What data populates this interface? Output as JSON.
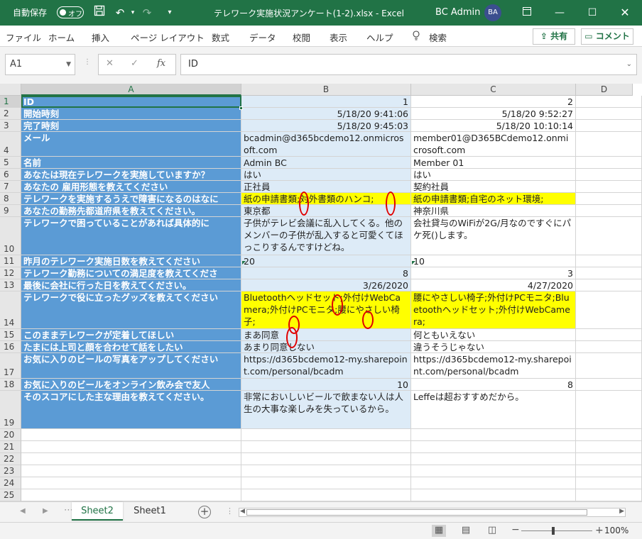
{
  "titlebar": {
    "autosave_label": "自動保存",
    "autosave_state": "オフ",
    "document_title": "テレワーク実施状況アンケート(1-2).xlsx  -  Excel",
    "user_name": "BC Admin",
    "user_initials": "BA"
  },
  "menu": {
    "file": "ファイル",
    "home": "ホーム",
    "insert": "挿入",
    "page_layout": "ページ レイアウト",
    "formulas": "数式",
    "data": "データ",
    "review": "校閲",
    "view": "表示",
    "help": "ヘルプ",
    "search": "検索",
    "share": "共有",
    "comments": "コメント"
  },
  "formula_bar": {
    "name_box": "A1",
    "fx": "fx",
    "value": "ID"
  },
  "columns": [
    "A",
    "B",
    "C",
    "D"
  ],
  "rows": [
    {
      "n": "1",
      "a": "ID",
      "b": "1",
      "c": "2"
    },
    {
      "n": "2",
      "a": "開始時刻",
      "b": "5/18/20 9:41:06",
      "c": "5/18/20 9:52:27"
    },
    {
      "n": "3",
      "a": "完了時刻",
      "b": "5/18/20 9:45:03",
      "c": "5/18/20 10:10:14"
    },
    {
      "n": "4",
      "a": "メール",
      "b": "bcadmin@d365bcdemo12.onmicrosoft.com",
      "c": "member01@D365BCdemo12.onmicrosoft.com"
    },
    {
      "n": "5",
      "a": "名前",
      "b": "Admin BC",
      "c": "Member 01"
    },
    {
      "n": "6",
      "a": "あなたは現在テレワークを実施していますか？",
      "b": "はい",
      "c": "はい"
    },
    {
      "n": "7",
      "a": "あなたの 雇用形態を教えてください",
      "b": "正社員",
      "c": "契約社員"
    },
    {
      "n": "8",
      "a": "テレワークを実施するうえで障害になるのはなに",
      "b": "紙の申請書類;対外書類のハンコ;",
      "c": "紙の申請書類;自宅のネット環境;"
    },
    {
      "n": "9",
      "a": "あなたの勤務先都道府県を教えてください。",
      "b": "東京都",
      "c": "神奈川県"
    },
    {
      "n": "10",
      "a": "テレワークで困っていることがあれば具体的に",
      "b": "子供がテレビ会議に乱入してくる。他のメンバーの子供が乱入すると可愛くてほっこりするんですけどね。",
      "c": "会社貸与のWiFiが2G/月なのですぐにパケ死()します。"
    },
    {
      "n": "11",
      "a": "昨月のテレワーク実施日数を教えてください",
      "b": "20",
      "c": "10"
    },
    {
      "n": "12",
      "a": "テレワーク勤務についての満足度を教えてくださ",
      "b": "8",
      "c": "3"
    },
    {
      "n": "13",
      "a": "最後に会社に行った日を教えてください。",
      "b": "3/26/2020",
      "c": "4/27/2020"
    },
    {
      "n": "14",
      "a": "テレワークで役に立ったグッズを教えてください",
      "b": "Bluetoothヘッドセット;外付けWebCamera;外付けPCモニタ;腰にやさしい椅子;",
      "c": "腰にやさしい椅子;外付けPCモニタ;Bluetoothヘッドセット;外付けWebCamera;"
    },
    {
      "n": "15",
      "a": "このままテレワークが定着してほしい",
      "b": "まあ同意",
      "c": "何ともいえない"
    },
    {
      "n": "16",
      "a": "たまには上司と顔を合わせて話をしたい",
      "b": "あまり同意しない",
      "c": "違うそうじゃない"
    },
    {
      "n": "17",
      "a": "お気に入りのビールの写真をアップしてください",
      "b": "https://d365bcdemo12-my.sharepoint.com/personal/bcadm",
      "c": "https://d365bcdemo12-my.sharepoint.com/personal/bcadm"
    },
    {
      "n": "18",
      "a": "お気に入りのビールをオンライン飲み会で友人",
      "b": "10",
      "c": "8"
    },
    {
      "n": "19",
      "a": "そのスコアにした主な理由を教えてください。",
      "b": "非常においしいビールで飲まない人は人生の大事な楽しみを失っているから。",
      "c": "Leffeは超おすすめだから。"
    },
    {
      "n": "20",
      "a": "",
      "b": "",
      "c": ""
    },
    {
      "n": "21",
      "a": "",
      "b": "",
      "c": ""
    },
    {
      "n": "22",
      "a": "",
      "b": "",
      "c": ""
    },
    {
      "n": "23",
      "a": "",
      "b": "",
      "c": ""
    },
    {
      "n": "24",
      "a": "",
      "b": "",
      "c": ""
    },
    {
      "n": "25",
      "a": "",
      "b": "",
      "c": ""
    }
  ],
  "sheets": [
    "Sheet2",
    "Sheet1"
  ],
  "status": {
    "zoom": "100%"
  },
  "colors": {
    "excel_green": "#217346",
    "header_blue": "#5b9bd5",
    "light_blue": "#ddebf7",
    "highlight_yellow": "#ffff00",
    "annotation_red": "#e00000"
  }
}
